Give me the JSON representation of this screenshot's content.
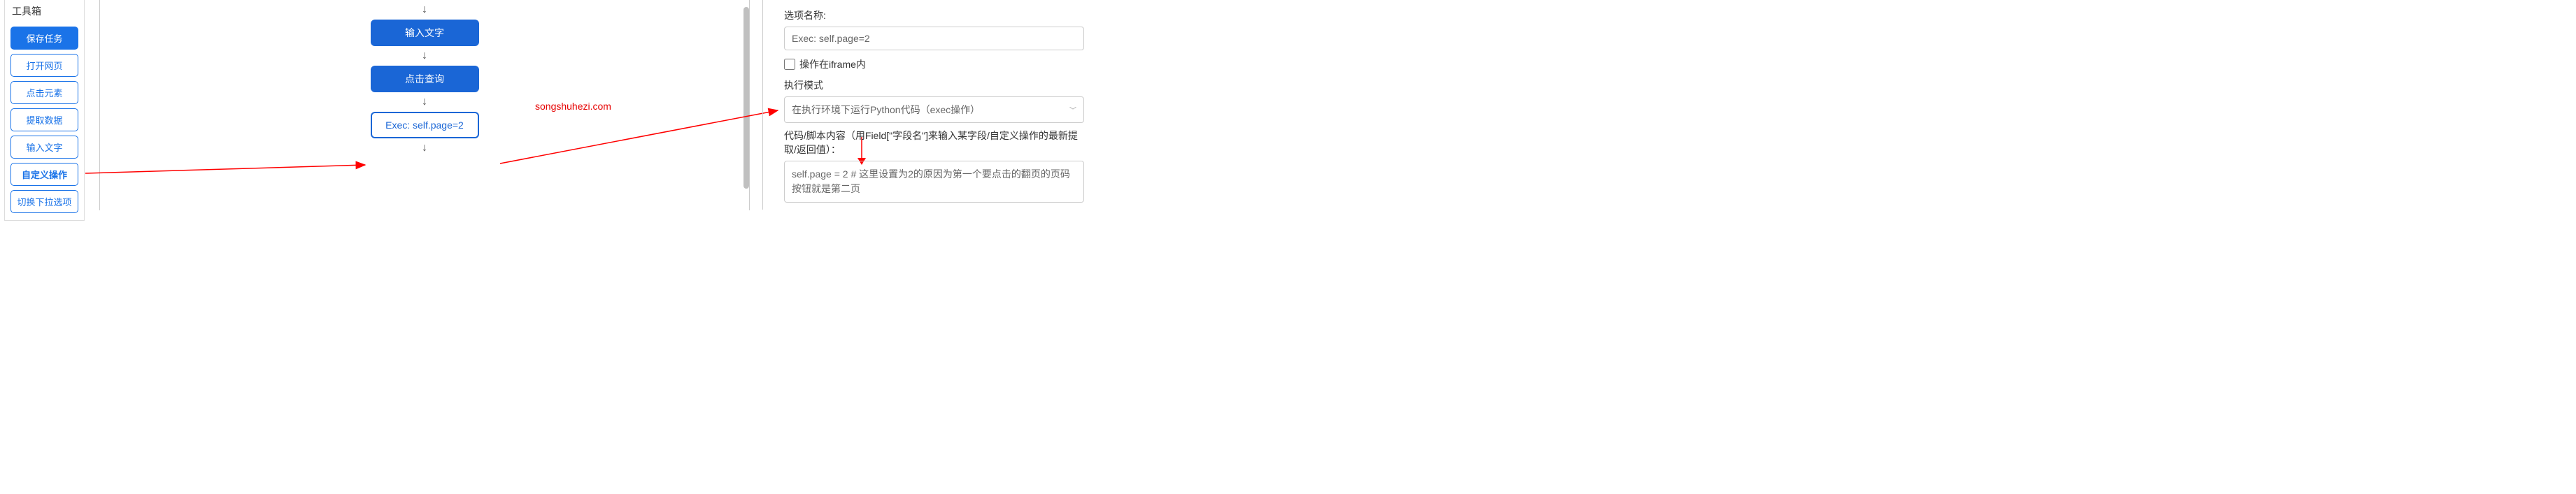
{
  "toolbox": {
    "title": "工具箱",
    "items": [
      {
        "label": "保存任务",
        "primary": true
      },
      {
        "label": "打开网页"
      },
      {
        "label": "点击元素"
      },
      {
        "label": "提取数据"
      },
      {
        "label": "输入文字"
      },
      {
        "label": "自定义操作",
        "active": true
      },
      {
        "label": "切换下拉选项"
      }
    ]
  },
  "flow": {
    "nodes": [
      {
        "label": "输入文字",
        "type": "blue"
      },
      {
        "label": "点击查询",
        "type": "blue"
      },
      {
        "label": "Exec: self.page=2",
        "type": "selected"
      }
    ]
  },
  "watermark": "songshuhezi.com",
  "panel": {
    "option_name_label": "选项名称:",
    "option_name_value": "Exec: self.page=2",
    "iframe_checkbox_label": "操作在iframe内",
    "iframe_checked": false,
    "exec_mode_label": "执行模式",
    "exec_mode_value": "在执行环境下运行Python代码（exec操作）",
    "code_label": "代码/脚本内容（用Field[\"字段名\"]来输入某字段/自定义操作的最新提取/返回值）：",
    "code_value": "self.page = 2 # 这里设置为2的原因为第一个要点击的翻页的页码按钮就是第二页"
  }
}
